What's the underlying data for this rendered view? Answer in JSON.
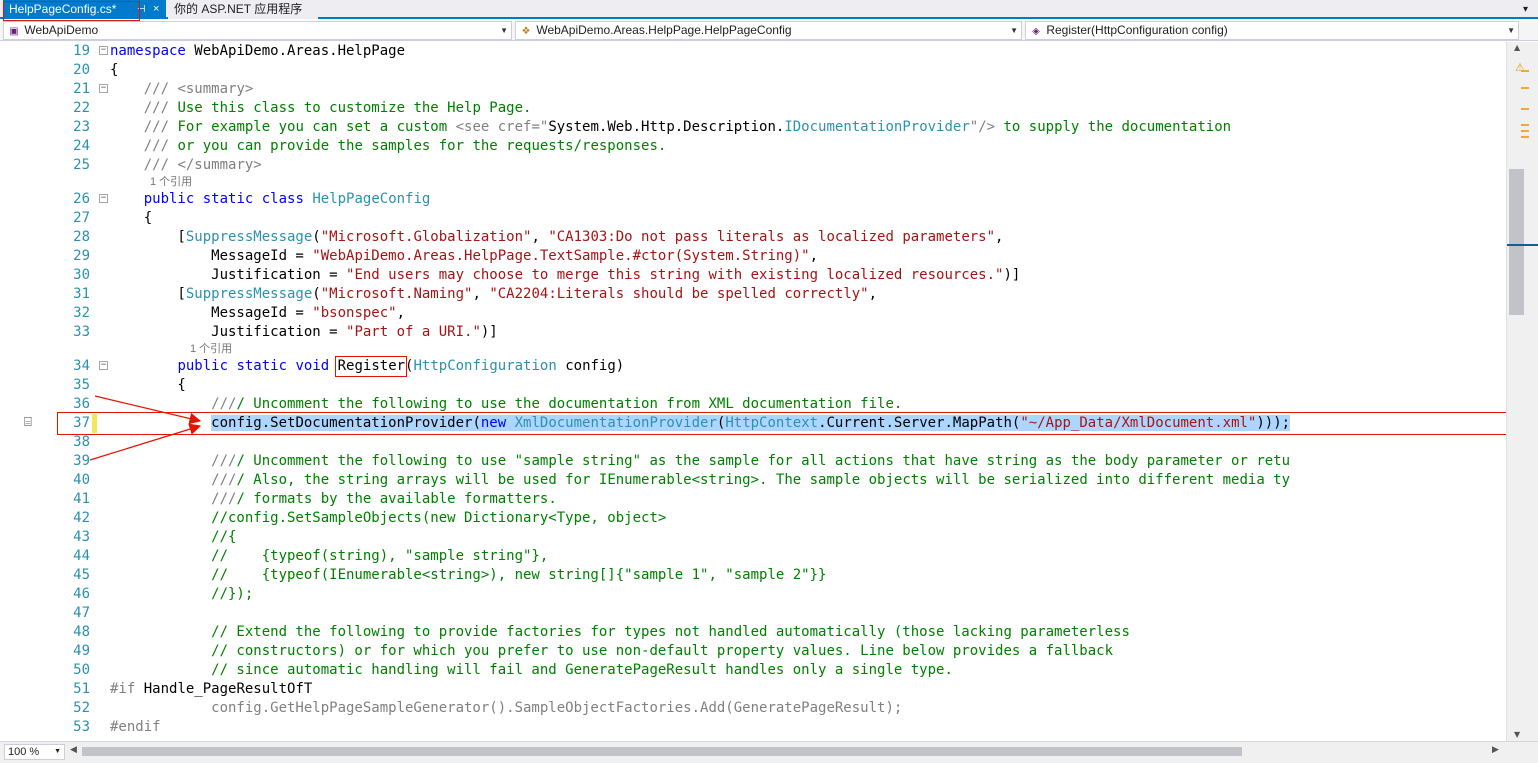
{
  "tabs": {
    "active": "HelpPageConfig.cs*",
    "inactive": "你的 ASP.NET 应用程序",
    "pin_glyph": "⊣",
    "close_glyph": "×"
  },
  "navbar": {
    "project": "WebApiDemo",
    "class": "WebApiDemo.Areas.HelpPage.HelpPageConfig",
    "member": "Register(HttpConfiguration config)"
  },
  "code": {
    "ref_hint_1": "1 个引用",
    "ref_hint_2": "1 个引用",
    "lines": [
      {
        "n": "19",
        "text": "namespace WebApiDemo.Areas.HelpPage"
      },
      {
        "n": "20",
        "text": "{"
      },
      {
        "n": "21",
        "text": "    /// <summary>"
      },
      {
        "n": "22",
        "text": "    /// Use this class to customize the Help Page."
      },
      {
        "n": "23",
        "text": "    /// For example you can set a custom <see cref=\"System.Web.Http.Description.IDocumentationProvider\"/> to supply the documentation"
      },
      {
        "n": "24",
        "text": "    /// or you can provide the samples for the requests/responses."
      },
      {
        "n": "25",
        "text": "    /// </summary>"
      },
      {
        "n": "26",
        "text": "    public static class HelpPageConfig"
      },
      {
        "n": "27",
        "text": "    {"
      },
      {
        "n": "28",
        "text": "        [SuppressMessage(\"Microsoft.Globalization\", \"CA1303:Do not pass literals as localized parameters\","
      },
      {
        "n": "29",
        "text": "            MessageId = \"WebApiDemo.Areas.HelpPage.TextSample.#ctor(System.String)\","
      },
      {
        "n": "30",
        "text": "            Justification = \"End users may choose to merge this string with existing localized resources.\")]"
      },
      {
        "n": "31",
        "text": "        [SuppressMessage(\"Microsoft.Naming\", \"CA2204:Literals should be spelled correctly\","
      },
      {
        "n": "32",
        "text": "            MessageId = \"bsonspec\","
      },
      {
        "n": "33",
        "text": "            Justification = \"Part of a URI.\")]"
      },
      {
        "n": "34",
        "text": "        public static void Register(HttpConfiguration config)"
      },
      {
        "n": "35",
        "text": "        {"
      },
      {
        "n": "36",
        "text": "            //// Uncomment the following to use the documentation from XML documentation file."
      },
      {
        "n": "37",
        "text": "            config.SetDocumentationProvider(new XmlDocumentationProvider(HttpContext.Current.Server.MapPath(\"~/App_Data/XmlDocument.xml\")));"
      },
      {
        "n": "38",
        "text": ""
      },
      {
        "n": "39",
        "text": "            //// Uncomment the following to use \"sample string\" as the sample for all actions that have string as the body parameter or retu"
      },
      {
        "n": "40",
        "text": "            //// Also, the string arrays will be used for IEnumerable<string>. The sample objects will be serialized into different media ty"
      },
      {
        "n": "41",
        "text": "            //// formats by the available formatters."
      },
      {
        "n": "42",
        "text": "            //config.SetSampleObjects(new Dictionary<Type, object>"
      },
      {
        "n": "43",
        "text": "            //{"
      },
      {
        "n": "44",
        "text": "            //    {typeof(string), \"sample string\"},"
      },
      {
        "n": "45",
        "text": "            //    {typeof(IEnumerable<string>), new string[]{\"sample 1\", \"sample 2\"}}"
      },
      {
        "n": "46",
        "text": "            //});"
      },
      {
        "n": "47",
        "text": ""
      },
      {
        "n": "48",
        "text": "            // Extend the following to provide factories for types not handled automatically (those lacking parameterless"
      },
      {
        "n": "49",
        "text": "            // constructors) or for which you prefer to use non-default property values. Line below provides a fallback"
      },
      {
        "n": "50",
        "text": "            // since automatic handling will fail and GeneratePageResult handles only a single type."
      },
      {
        "n": "51",
        "text": "#if Handle_PageResultOfT"
      },
      {
        "n": "52",
        "text": "            config.GetHelpPageSampleGenerator().SampleObjectFactories.Add(GeneratePageResult);"
      },
      {
        "n": "53",
        "text": "#endif"
      }
    ]
  },
  "zoom": "100 %",
  "icons": {
    "project": "csharp-project-icon",
    "class": "class-icon",
    "member": "method-icon",
    "warning": "warning-icon",
    "brush": "quick-action-brush-icon"
  },
  "colors": {
    "keyword": "#0000ff",
    "type": "#2b91af",
    "string": "#a31515",
    "comment": "#008000",
    "xmldoc": "#808080",
    "selection": "#add6ff",
    "annotation": "#e51400",
    "tab_active": "#007acc"
  }
}
